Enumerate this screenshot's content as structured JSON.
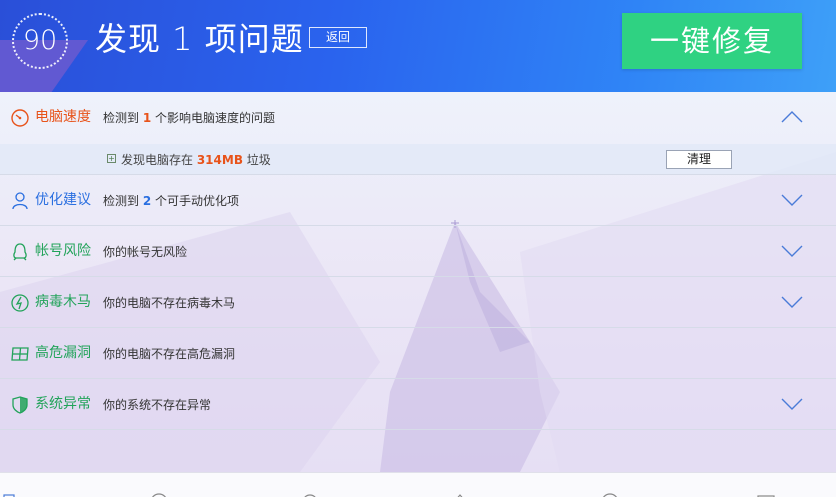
{
  "header": {
    "score": "90",
    "title": "发现 1 项问题",
    "back_label": "返回",
    "fix_label": "一键修复"
  },
  "rows": [
    {
      "label": "电脑速度",
      "desc_pre": "检测到 ",
      "desc_num": "1",
      "desc_post": " 个影响电脑速度的问题",
      "icon": "speedometer-icon",
      "color": "#e8531a",
      "expanded": true
    },
    {
      "label": "优化建议",
      "desc_pre": "检测到 ",
      "desc_num": "2",
      "desc_post": " 个可手动优化项",
      "icon": "person-icon",
      "color": "#2a6fe0"
    },
    {
      "label": "帐号风险",
      "desc": "你的帐号无风险",
      "icon": "penguin-icon",
      "color": "#22a35a"
    },
    {
      "label": "病毒木马",
      "desc": "你的电脑不存在病毒木马",
      "icon": "lightning-shield-icon",
      "color": "#22a35a"
    },
    {
      "label": "高危漏洞",
      "desc": "你的电脑不存在高危漏洞",
      "icon": "grid-icon",
      "color": "#22a35a"
    },
    {
      "label": "系统异常",
      "desc": "你的系统不存在异常",
      "icon": "shield-icon",
      "color": "#22a35a"
    }
  ],
  "sub_item": {
    "text_pre": "发现电脑存在 ",
    "size": "314MB",
    "text_post": " 垃圾",
    "button": "清理"
  },
  "colors": {
    "header_start": "#2a4fd8",
    "header_end": "#3ea0f8",
    "fix_button": "#2fd282",
    "chevron": "#4a7bd8"
  }
}
